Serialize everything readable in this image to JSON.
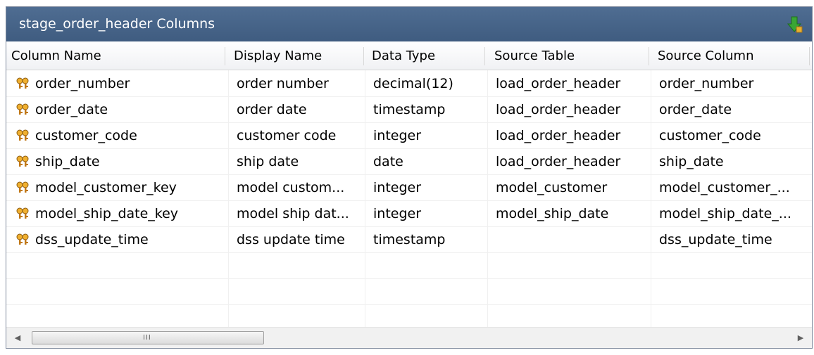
{
  "window": {
    "title": "stage_order_header Columns"
  },
  "icons": {
    "title_icon": "green-down-arrow-icon",
    "row_icon": "key-icon"
  },
  "table": {
    "columns": [
      "Column Name",
      "Display Name",
      "Data Type",
      "Source Table",
      "Source Column"
    ],
    "rows": [
      [
        "order_number",
        "order number",
        "decimal(12)",
        "load_order_header",
        "order_number"
      ],
      [
        "order_date",
        "order date",
        "timestamp",
        "load_order_header",
        "order_date"
      ],
      [
        "customer_code",
        "customer code",
        "integer",
        "load_order_header",
        "customer_code"
      ],
      [
        "ship_date",
        "ship date",
        "date",
        "load_order_header",
        "ship_date"
      ],
      [
        "model_customer_key",
        "model custom...",
        "integer",
        "model_customer",
        "model_customer_..."
      ],
      [
        "model_ship_date_key",
        "model ship dat...",
        "integer",
        "model_ship_date",
        "model_ship_date_..."
      ],
      [
        "dss_update_time",
        "dss update time",
        "timestamp",
        "",
        "dss_update_time"
      ]
    ]
  },
  "scrollbar": {
    "grip": "III"
  }
}
